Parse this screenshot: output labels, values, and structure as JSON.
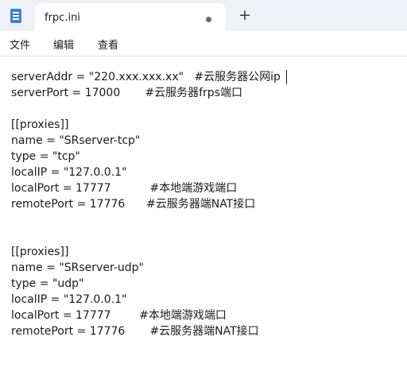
{
  "tab": {
    "title": "frpc.ini"
  },
  "new_tab_glyph": "+",
  "menu": [
    "文件",
    "编辑",
    "查看"
  ],
  "editor": {
    "lines": [
      "serverAddr = \"220.xxx.xxx.xx\"   #云服务器公网ip",
      "serverPort = 17000       #云服务器frps端口",
      "",
      "[[proxies]]",
      "name = \"SRserver-tcp\"",
      "type = \"tcp\"",
      "localIP = \"127.0.0.1\"",
      "localPort = 17777           #本地端游戏端口",
      "remotePort = 17776      #云服务器端NAT接口",
      "",
      "",
      "[[proxies]]",
      "name = \"SRserver-udp\"",
      "type = \"udp\"",
      "localIP = \"127.0.0.1\"",
      "localPort = 17777        #本地端游戏端口",
      "remotePort = 17776       #云服务器端NAT接口"
    ]
  },
  "colors": {
    "accent": "#3f7fcf",
    "titlebar": "#eef2f6"
  }
}
